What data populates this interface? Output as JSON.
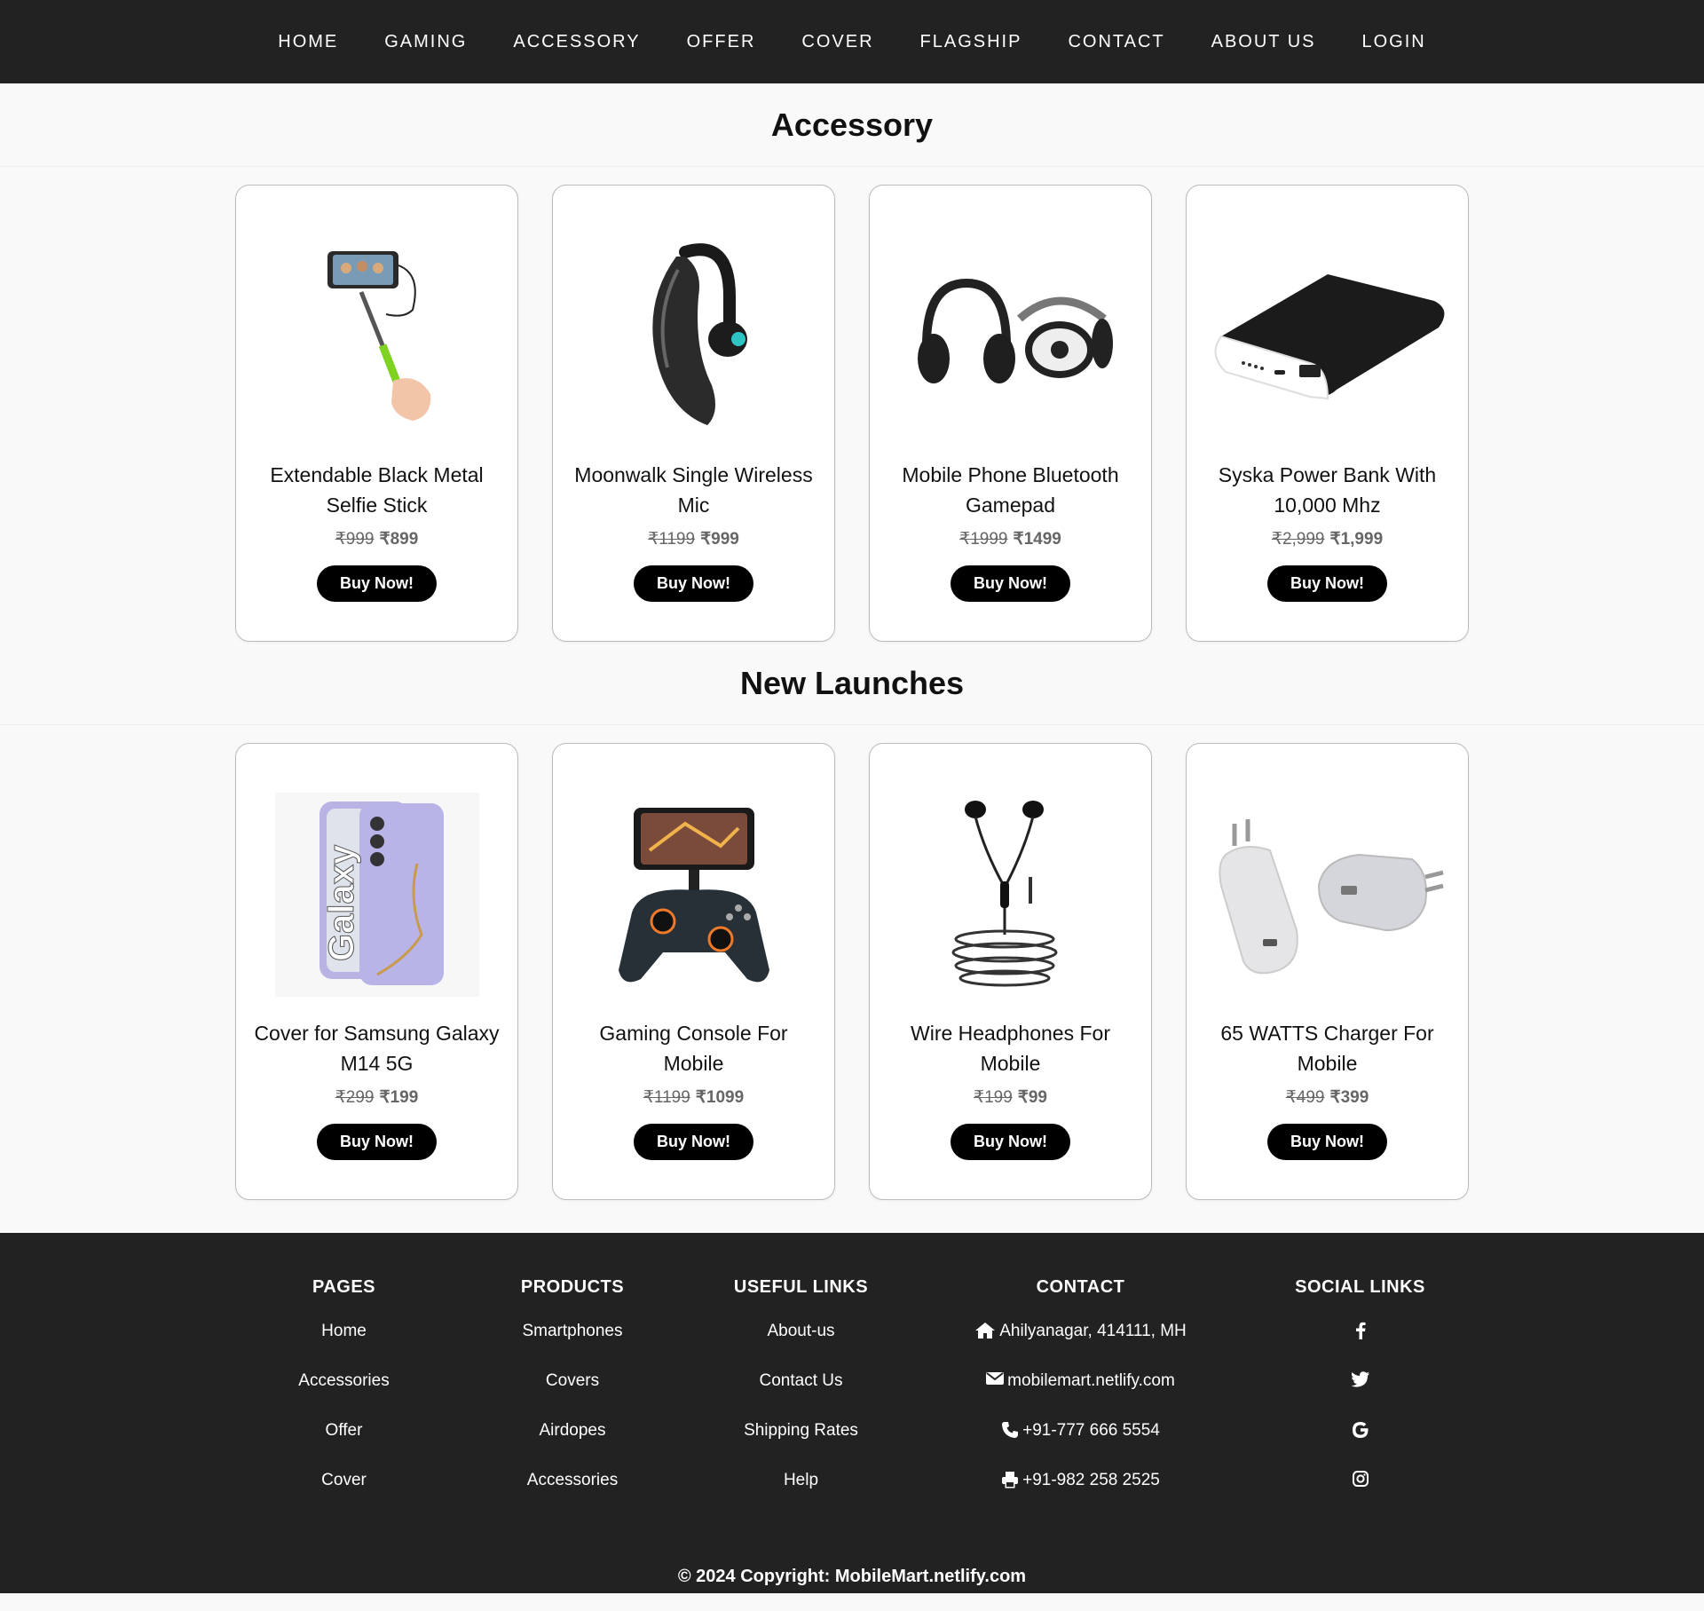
{
  "nav": [
    "HOME",
    "GAMING",
    "ACCESSORY",
    "OFFER",
    "COVER",
    "FLAGSHIP",
    "CONTACT",
    "ABOUT US",
    "LOGIN"
  ],
  "sections": [
    {
      "title": "Accessory",
      "products": [
        {
          "name": "Extendable Black Metal Selfie Stick",
          "old_price": "₹999",
          "price": "₹899",
          "button": "Buy Now!",
          "image": "selfie-stick"
        },
        {
          "name": "Moonwalk Single Wireless Mic",
          "old_price": "₹1199",
          "price": "₹999",
          "button": "Buy Now!",
          "image": "bluetooth-earpiece"
        },
        {
          "name": "Mobile Phone Bluetooth Gamepad",
          "old_price": "₹1999",
          "price": "₹1499",
          "button": "Buy Now!",
          "image": "headphones"
        },
        {
          "name": "Syska Power Bank With 10,000 Mhz",
          "old_price": "₹2,999",
          "price": "₹1,999",
          "button": "Buy Now!",
          "image": "power-bank"
        }
      ]
    },
    {
      "title": "New Launches",
      "products": [
        {
          "name": "Cover for Samsung Galaxy M14 5G",
          "old_price": "₹299",
          "price": "₹199",
          "button": "Buy Now!",
          "image": "phone-cover",
          "image_text": "Galaxy"
        },
        {
          "name": "Gaming Console For Mobile",
          "old_price": "₹1199",
          "price": "₹1099",
          "button": "Buy Now!",
          "image": "game-controller"
        },
        {
          "name": "Wire Headphones For Mobile",
          "old_price": "₹199",
          "price": "₹99",
          "button": "Buy Now!",
          "image": "wired-earphones"
        },
        {
          "name": "65 WATTS Charger For Mobile",
          "old_price": "₹499",
          "price": "₹399",
          "button": "Buy Now!",
          "image": "charger"
        }
      ]
    }
  ],
  "footer": {
    "pages": {
      "title": "PAGES",
      "items": [
        "Home",
        "Accessories",
        "Offer",
        "Cover"
      ]
    },
    "products": {
      "title": "PRODUCTS",
      "items": [
        "Smartphones",
        "Covers",
        "Airdopes",
        "Accessories"
      ]
    },
    "links": {
      "title": "USEFUL LINKS",
      "items": [
        "About-us",
        "Contact Us",
        "Shipping Rates",
        "Help"
      ]
    },
    "contact": {
      "title": "CONTACT",
      "items": [
        {
          "icon": "home-icon",
          "text": "Ahilyanagar, 414111, MH"
        },
        {
          "icon": "envelope-icon",
          "text": "mobilemart.netlify.com"
        },
        {
          "icon": "phone-icon",
          "text": "+91-777 666 5554"
        },
        {
          "icon": "printer-icon",
          "text": "+91-982 258 2525"
        }
      ]
    },
    "social": {
      "title": "SOCIAL LINKS",
      "items": [
        "facebook-icon",
        "twitter-icon",
        "google-icon",
        "instagram-icon"
      ]
    },
    "copyright": "© 2024 Copyright: MobileMart.netlify.com"
  }
}
